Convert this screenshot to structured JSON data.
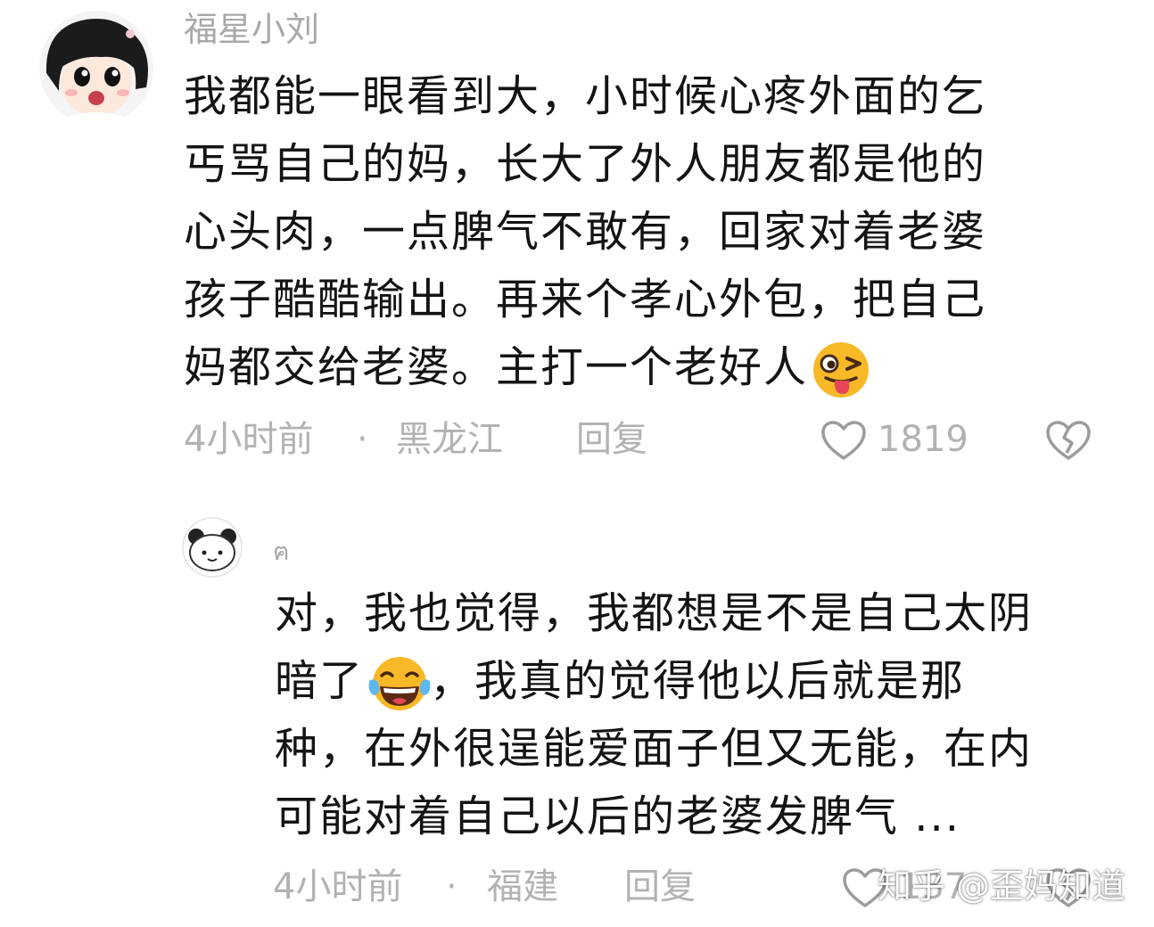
{
  "comments": [
    {
      "username": "福星小刘",
      "lines": [
        "我都能一眼看到大，小时候心疼外面的乞",
        "丐骂自己的妈，长大了外人朋友都是他的",
        "心头肉，一点脾气不敢有，回家对着老婆",
        "孩子酷酷输出。再来个孝心外包，把自己",
        "妈都交给老婆。主打一个老好人"
      ],
      "emoji": "winking-tongue-emoji",
      "time": "4小时前",
      "separator": "·",
      "location": "黑龙江",
      "reply_label": "回复",
      "like_count": "1819",
      "like_icon": "heart-outline-icon",
      "dislike_icon": "broken-heart-icon"
    },
    {
      "username": "ฅ",
      "lines": [
        "对，我也觉得，我都想是不是自己太阴",
        "暗了",
        "，我真的觉得他以后就是那",
        "种，在外很逞能爱面子但又无能，在内",
        "可能对着自己以后的老婆发脾气 ..."
      ],
      "emoji": "crying-laughing-emoji",
      "time": "4小时前",
      "separator": "·",
      "location": "福建",
      "reply_label": "回复",
      "like_count": "137",
      "like_icon": "heart-outline-icon",
      "dislike_icon": "broken-heart-icon"
    }
  ],
  "watermark": "知乎 @歪妈知道",
  "colors": {
    "text": "#141414",
    "meta": "#b2b2b2",
    "username": "#a8a8a8",
    "emoji_face": "#f7b928",
    "emoji_tongue": "#e8455a"
  }
}
